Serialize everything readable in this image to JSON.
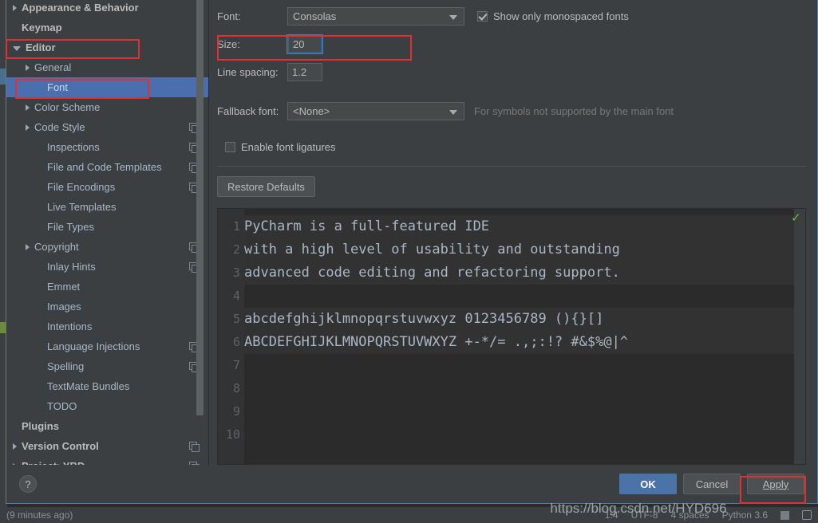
{
  "sidebar": {
    "items": [
      {
        "label": "Appearance & Behavior",
        "level": 0,
        "arrow": "right",
        "bold": true,
        "copy": false,
        "selected": false
      },
      {
        "label": "Keymap",
        "level": 0,
        "arrow": "none",
        "bold": true,
        "copy": false,
        "selected": false
      },
      {
        "label": "Editor",
        "level": 0,
        "arrow": "down",
        "bold": true,
        "copy": false,
        "selected": false
      },
      {
        "label": "General",
        "level": 1,
        "arrow": "right",
        "bold": false,
        "copy": false,
        "selected": false
      },
      {
        "label": "Font",
        "level": 2,
        "arrow": "none",
        "bold": false,
        "copy": false,
        "selected": true
      },
      {
        "label": "Color Scheme",
        "level": 1,
        "arrow": "right",
        "bold": false,
        "copy": false,
        "selected": false
      },
      {
        "label": "Code Style",
        "level": 1,
        "arrow": "right",
        "bold": false,
        "copy": true,
        "selected": false
      },
      {
        "label": "Inspections",
        "level": 2,
        "arrow": "none",
        "bold": false,
        "copy": true,
        "selected": false
      },
      {
        "label": "File and Code Templates",
        "level": 2,
        "arrow": "none",
        "bold": false,
        "copy": true,
        "selected": false
      },
      {
        "label": "File Encodings",
        "level": 2,
        "arrow": "none",
        "bold": false,
        "copy": true,
        "selected": false
      },
      {
        "label": "Live Templates",
        "level": 2,
        "arrow": "none",
        "bold": false,
        "copy": false,
        "selected": false
      },
      {
        "label": "File Types",
        "level": 2,
        "arrow": "none",
        "bold": false,
        "copy": false,
        "selected": false
      },
      {
        "label": "Copyright",
        "level": 1,
        "arrow": "right",
        "bold": false,
        "copy": true,
        "selected": false
      },
      {
        "label": "Inlay Hints",
        "level": 2,
        "arrow": "none",
        "bold": false,
        "copy": true,
        "selected": false
      },
      {
        "label": "Emmet",
        "level": 2,
        "arrow": "none",
        "bold": false,
        "copy": false,
        "selected": false
      },
      {
        "label": "Images",
        "level": 2,
        "arrow": "none",
        "bold": false,
        "copy": false,
        "selected": false
      },
      {
        "label": "Intentions",
        "level": 2,
        "arrow": "none",
        "bold": false,
        "copy": false,
        "selected": false
      },
      {
        "label": "Language Injections",
        "level": 2,
        "arrow": "none",
        "bold": false,
        "copy": true,
        "selected": false
      },
      {
        "label": "Spelling",
        "level": 2,
        "arrow": "none",
        "bold": false,
        "copy": true,
        "selected": false
      },
      {
        "label": "TextMate Bundles",
        "level": 2,
        "arrow": "none",
        "bold": false,
        "copy": false,
        "selected": false
      },
      {
        "label": "TODO",
        "level": 2,
        "arrow": "none",
        "bold": false,
        "copy": false,
        "selected": false
      },
      {
        "label": "Plugins",
        "level": 0,
        "arrow": "none",
        "bold": true,
        "copy": false,
        "selected": false
      },
      {
        "label": "Version Control",
        "level": 0,
        "arrow": "right",
        "bold": true,
        "copy": true,
        "selected": false
      },
      {
        "label": "Project: YBD",
        "level": 0,
        "arrow": "right",
        "bold": true,
        "copy": true,
        "selected": false
      }
    ]
  },
  "form": {
    "font_label": "Font:",
    "font_value": "Consolas",
    "show_monospaced_label": "Show only monospaced fonts",
    "size_label": "Size:",
    "size_value": "20",
    "line_spacing_label": "Line spacing:",
    "line_spacing_value": "1.2",
    "fallback_label": "Fallback font:",
    "fallback_value": "<None>",
    "fallback_hint": "For symbols not supported by the main font",
    "ligatures_label": "Enable font ligatures",
    "restore_defaults_label": "Restore Defaults"
  },
  "preview": {
    "line_numbers": [
      "1",
      "2",
      "3",
      "4",
      "5",
      "6",
      "7",
      "8",
      "9",
      "10"
    ],
    "lines": [
      "PyCharm is a full-featured IDE",
      "with a high level of usability and outstanding",
      "advanced code editing and refactoring support.",
      "",
      "abcdefghijklmnopqrstuvwxyz 0123456789 (){}[]",
      "ABCDEFGHIJKLMNOPQRSTUVWXYZ +-*/= .,;:!? #&$%@|^",
      "",
      "",
      "",
      ""
    ]
  },
  "footer": {
    "help_label": "?",
    "ok_label": "OK",
    "cancel_label": "Cancel",
    "apply_label": "Apply"
  },
  "statusbar": {
    "left_text": "(9 minutes ago)",
    "caret": "1:4",
    "encoding": "UTF-8",
    "indent": "4 spaces",
    "interpreter": "Python 3.6"
  },
  "watermark": {
    "text": "https://blog.csdn.net/HYD696"
  },
  "colors": {
    "panel_bg": "#3c3f41",
    "editor_bg": "#2b2b2b",
    "selection_blue": "#4b6eaf",
    "accent_ok": "#4a74a8",
    "annotation_red": "#e03131",
    "focus_blue": "#4a7ebb",
    "ok_check_green": "#6bbf4a"
  }
}
